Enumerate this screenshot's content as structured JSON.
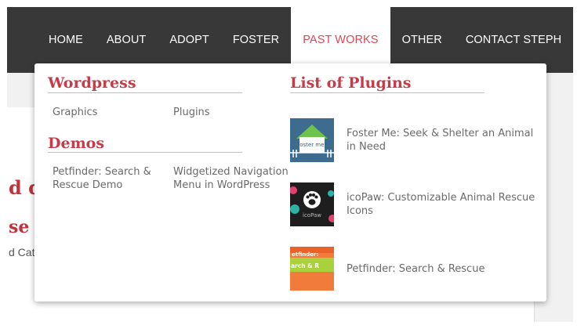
{
  "nav": {
    "items": [
      {
        "label": "HOME",
        "active": false
      },
      {
        "label": "ABOUT",
        "active": false
      },
      {
        "label": "ADOPT",
        "active": false
      },
      {
        "label": "FOSTER",
        "active": false
      },
      {
        "label": "PAST WORKS",
        "active": true
      },
      {
        "label": "OTHER",
        "active": false
      },
      {
        "label": "CONTACT STEPH",
        "active": false
      }
    ],
    "search_icon": "search-icon"
  },
  "background": {
    "title_fragment_1": "d dev",
    "title_fragment_2": "se fo",
    "meta_fragment": "d Cate"
  },
  "dropdown": {
    "wordpress": {
      "heading": "Wordpress",
      "links": [
        "Graphics",
        "Plugins"
      ]
    },
    "demos": {
      "heading": "Demos",
      "links": [
        "Petfinder: Search & Rescue Demo",
        "Widgetized Navigation Menu in WordPress"
      ]
    },
    "plugins": {
      "heading": "List of Plugins",
      "items": [
        {
          "name": "Foster Me: Seek & Shelter an Animal in Need",
          "thumb_text": "foster me!"
        },
        {
          "name": "icoPaw: Customizable Animal Rescue Icons",
          "thumb_text": "icoPaw"
        },
        {
          "name": "Petfinder: Search & Rescue",
          "thumb_text_top": "etfinder:",
          "thumb_text_bottom": "arch & R"
        }
      ]
    }
  },
  "colors": {
    "navbar": "#383838",
    "accent_red": "#c63b47",
    "active_nav_text": "#d24b58",
    "link_gray": "#6a6a6a"
  }
}
